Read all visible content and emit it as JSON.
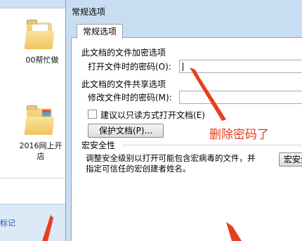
{
  "explorer": {
    "folders": [
      {
        "label": "00帮忙做"
      },
      {
        "label": "2016网上开店"
      }
    ],
    "status_text": "标记"
  },
  "dialog": {
    "title": "常规选项",
    "tab_label": "常规选项",
    "encrypt_section": {
      "heading": "此文档的文件加密选项",
      "open_password_label": "打开文件时的密码(O):",
      "open_password_value": ""
    },
    "share_section": {
      "heading": "此文档的文件共享选项",
      "modify_password_label": "修改文件时的密码(M):",
      "modify_password_value": "",
      "readonly_checkbox_label": "建议以只读方式打开文档(E)",
      "readonly_checked": false,
      "protect_button_label": "保护文档(P)..."
    },
    "macro_section": {
      "heading": "宏安全性",
      "description_line1": "调整安全级别以打开可能包含宏病毒的文件，并",
      "description_line2": "指定可信任的宏创建者姓名。",
      "macro_security_button_label": "宏安全性"
    }
  },
  "annotation": {
    "text": "删除密码了",
    "color": "#e23b1f"
  }
}
